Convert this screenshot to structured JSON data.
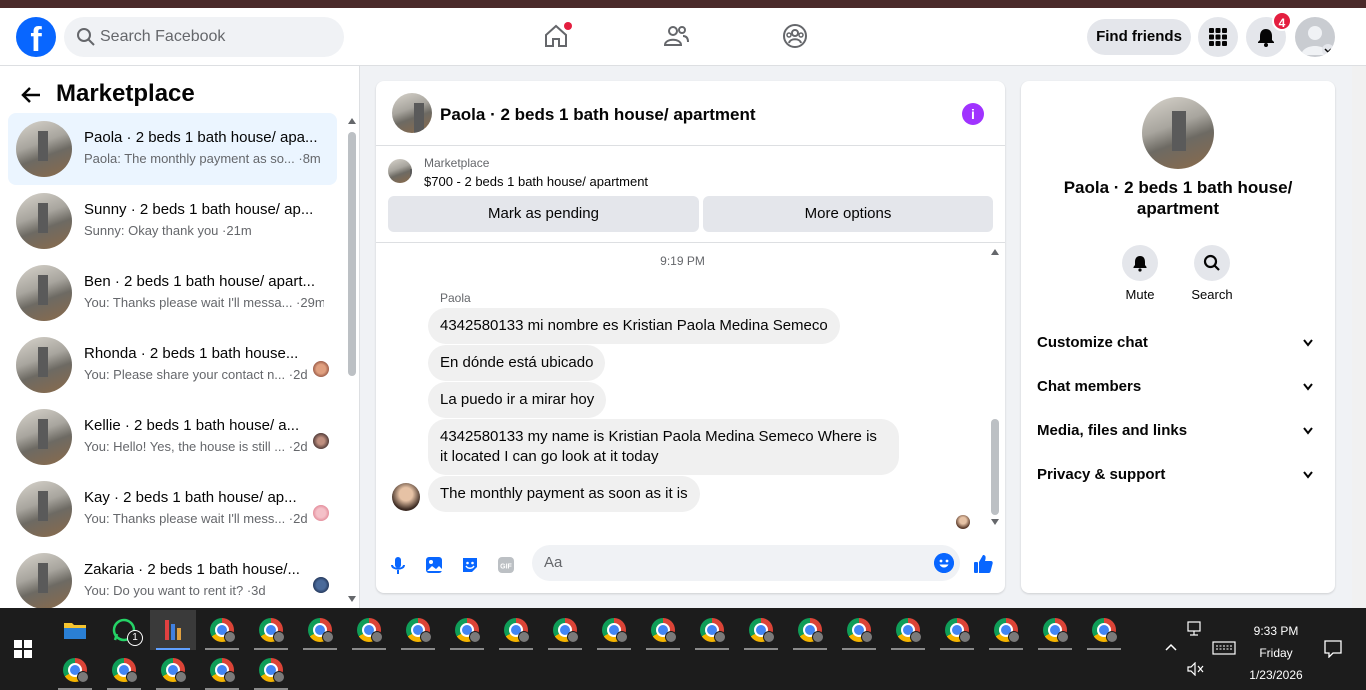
{
  "topbar": {
    "search_placeholder": "Search Facebook",
    "find_friends": "Find friends",
    "notification_count": "4"
  },
  "sidebar": {
    "title": "Marketplace",
    "conversations": [
      {
        "name": "Paola · 2 beds 1 bath house/ apa...",
        "snippet": "Paola: The monthly payment as so... ·8m",
        "active": true
      },
      {
        "name": "Sunny · 2 beds 1 bath house/ ap...",
        "snippet": "Sunny: Okay thank you ·21m"
      },
      {
        "name": "Ben · 2 beds 1 bath house/ apart...",
        "snippet": "You: Thanks please wait I'll messa... ·29m"
      },
      {
        "name": "Rhonda · 2 beds 1 bath house...",
        "snippet": "You: Please share your contact n... ·2d"
      },
      {
        "name": "Kellie · 2 beds 1 bath house/ a...",
        "snippet": "You: Hello! Yes, the house is still ... ·2d"
      },
      {
        "name": "Kay · 2 beds 1 bath house/ ap...",
        "snippet": "You: Thanks please wait I'll mess... ·2d"
      },
      {
        "name": "Zakaria · 2 beds 1 bath house/...",
        "snippet": "You: Do you want to rent it? ·3d"
      }
    ]
  },
  "chat": {
    "title": "Paola · 2 beds 1 bath house/ apartment",
    "marketplace_label": "Marketplace",
    "listing": "$700 - 2 beds 1 bath house/ apartment",
    "mark_pending": "Mark as pending",
    "more_options": "More options",
    "timestamp": "9:19 PM",
    "sender": "Paola",
    "messages": [
      "4342580133 mi nombre es Kristian Paola Medina Semeco",
      "En dónde está ubicado",
      "La puedo ir a mirar hoy",
      "4342580133 my name is Kristian Paola Medina Semeco Where is it located I can go look at it today",
      "The monthly payment as soon as it is"
    ],
    "input_placeholder": "Aa"
  },
  "details": {
    "name": "Paola · 2 beds 1 bath house/ apartment",
    "mute": "Mute",
    "search": "Search",
    "sections": [
      "Customize chat",
      "Chat members",
      "Media, files and links",
      "Privacy & support"
    ]
  },
  "taskbar": {
    "whatsapp_badge": "1",
    "time": "9:33 PM",
    "day": "Friday",
    "date": "1/23/2026"
  },
  "colors": {
    "brand_blue": "#0866ff",
    "notification_red": "#e41e3f",
    "info_purple": "#a033ff"
  }
}
